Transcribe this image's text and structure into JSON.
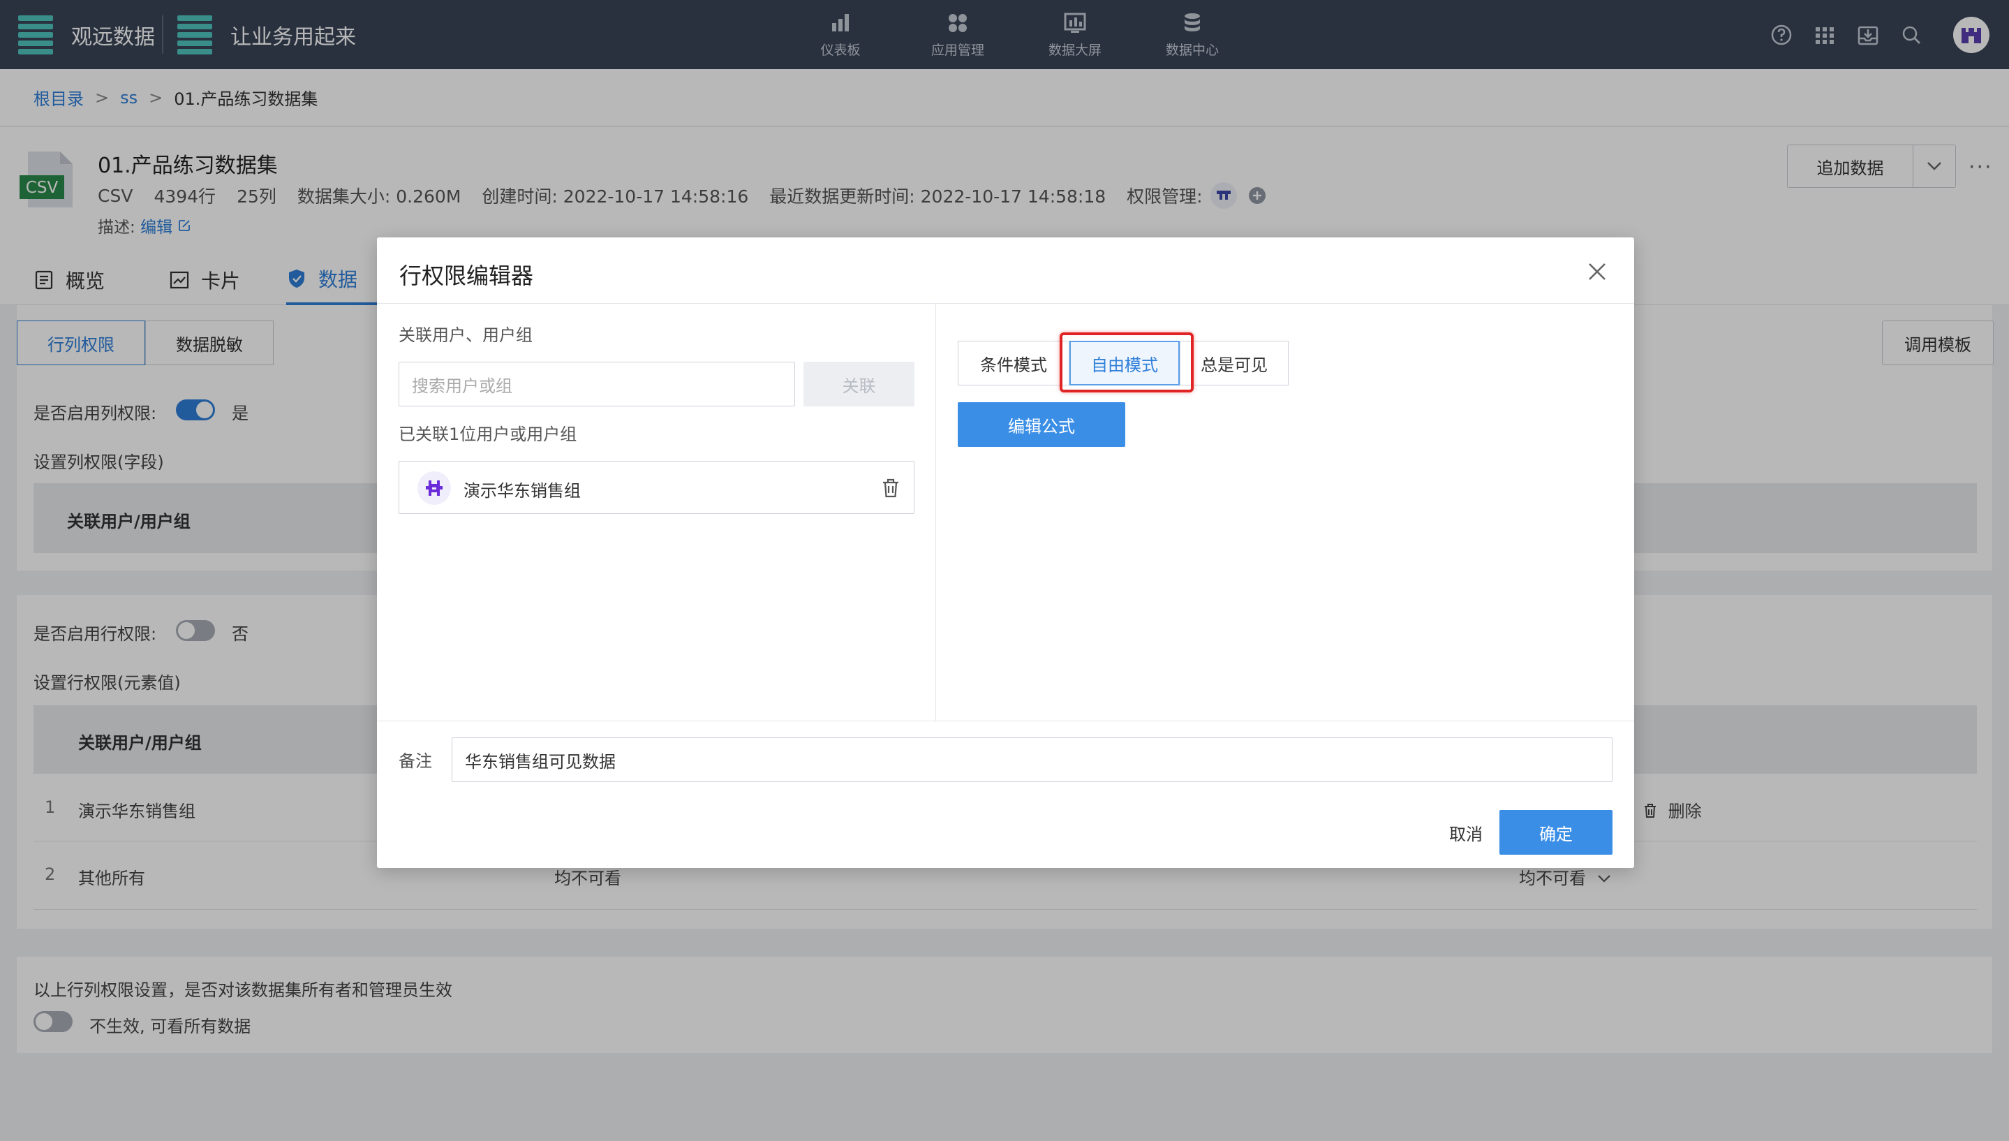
{
  "topbar": {
    "brand1": "观远数据",
    "brand2": "让业务用起来",
    "nav": [
      {
        "label": "仪表板",
        "icon": "bar-chart-icon"
      },
      {
        "label": "应用管理",
        "icon": "apps-icon"
      },
      {
        "label": "数据大屏",
        "icon": "screen-icon"
      },
      {
        "label": "数据中心",
        "icon": "database-icon"
      }
    ]
  },
  "breadcrumb": {
    "root": "根目录",
    "sep": ">",
    "folder": "ss",
    "current": "01.产品练习数据集"
  },
  "dataset": {
    "badge": "CSV",
    "title": "01.产品练习数据集",
    "type": "CSV",
    "rows": "4394行",
    "cols": "25列",
    "size": "数据集大小: 0.260M",
    "created": "创建时间: 2022-10-17 14:58:16",
    "updated": "最近数据更新时间: 2022-10-17 14:58:18",
    "perm_label": "权限管理:",
    "desc_label": "描述:",
    "desc_edit": "编辑",
    "append_label": "追加数据",
    "more": "···"
  },
  "tabs": [
    {
      "label": "概览"
    },
    {
      "label": "卡片"
    },
    {
      "label": "数据"
    }
  ],
  "perm": {
    "seg_rowcol": "行列权限",
    "seg_mask": "数据脱敏",
    "template_btn": "调用模板",
    "col_enable_label": "是否启用列权限:",
    "col_enable_value": "是",
    "col_set_label": "设置列权限(字段)",
    "col_table_head": "关联用户/用户组",
    "row_enable_label": "是否启用行权限:",
    "row_enable_value": "否",
    "row_set_label": "设置行权限(元素值)",
    "row_table_head": "关联用户/用户组",
    "rows": [
      {
        "idx": "1",
        "name": "演示华东销售组",
        "action": "删除"
      },
      {
        "idx": "2",
        "name": "其他所有",
        "mid": "均不可看",
        "right": "均不可看"
      }
    ],
    "owner_note": "以上行列权限设置，是否对该数据集所有者和管理员生效",
    "owner_value": "不生效, 可看所有数据"
  },
  "modal": {
    "title": "行权限编辑器",
    "assoc_label": "关联用户、用户组",
    "search_placeholder": "搜索用户或组",
    "assoc_btn": "关联",
    "linked_count": "已关联1位用户或用户组",
    "linked_item": "演示华东销售组",
    "mode_condition": "条件模式",
    "mode_free": "自由模式",
    "mode_always": "总是可见",
    "edit_formula": "编辑公式",
    "note_label": "备注",
    "note_value": "华东销售组可见数据",
    "cancel": "取消",
    "confirm": "确定"
  },
  "colors": {
    "topbar": "#3a4458",
    "accent": "#2f7fd9",
    "primary": "#3a8ee6",
    "brand_teal": "#4fc5c0",
    "highlight": "#e02424"
  }
}
